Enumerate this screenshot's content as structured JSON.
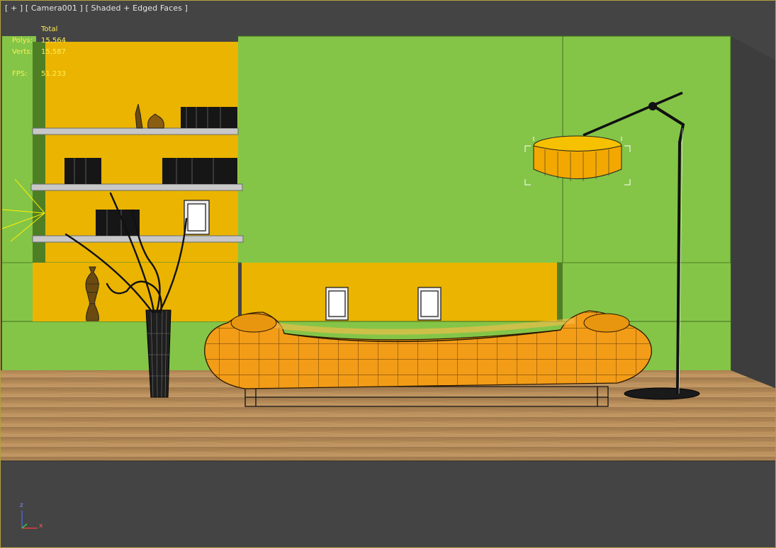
{
  "viewport": {
    "label_menu": "[ + ]",
    "label_camera": "[ Camera001 ]",
    "label_shading": "[ Shaded + Edged Faces ]"
  },
  "stats": {
    "header": "Total",
    "polys_label": "Polys:",
    "polys_value": "15,564",
    "verts_label": "Verts:",
    "verts_value": "15,587",
    "fps_label": "FPS:",
    "fps_value": "51.233"
  },
  "axis_tripod": {
    "z_label": "z",
    "x_label": "x"
  },
  "colors": {
    "background": "#444444",
    "wall_green": "#84c548",
    "shelf_yellow": "#eab400",
    "floor": "#b58a57",
    "sofa_orange": "#f29c18",
    "stats_text": "#ffee55",
    "selection_white": "#ffffff"
  }
}
